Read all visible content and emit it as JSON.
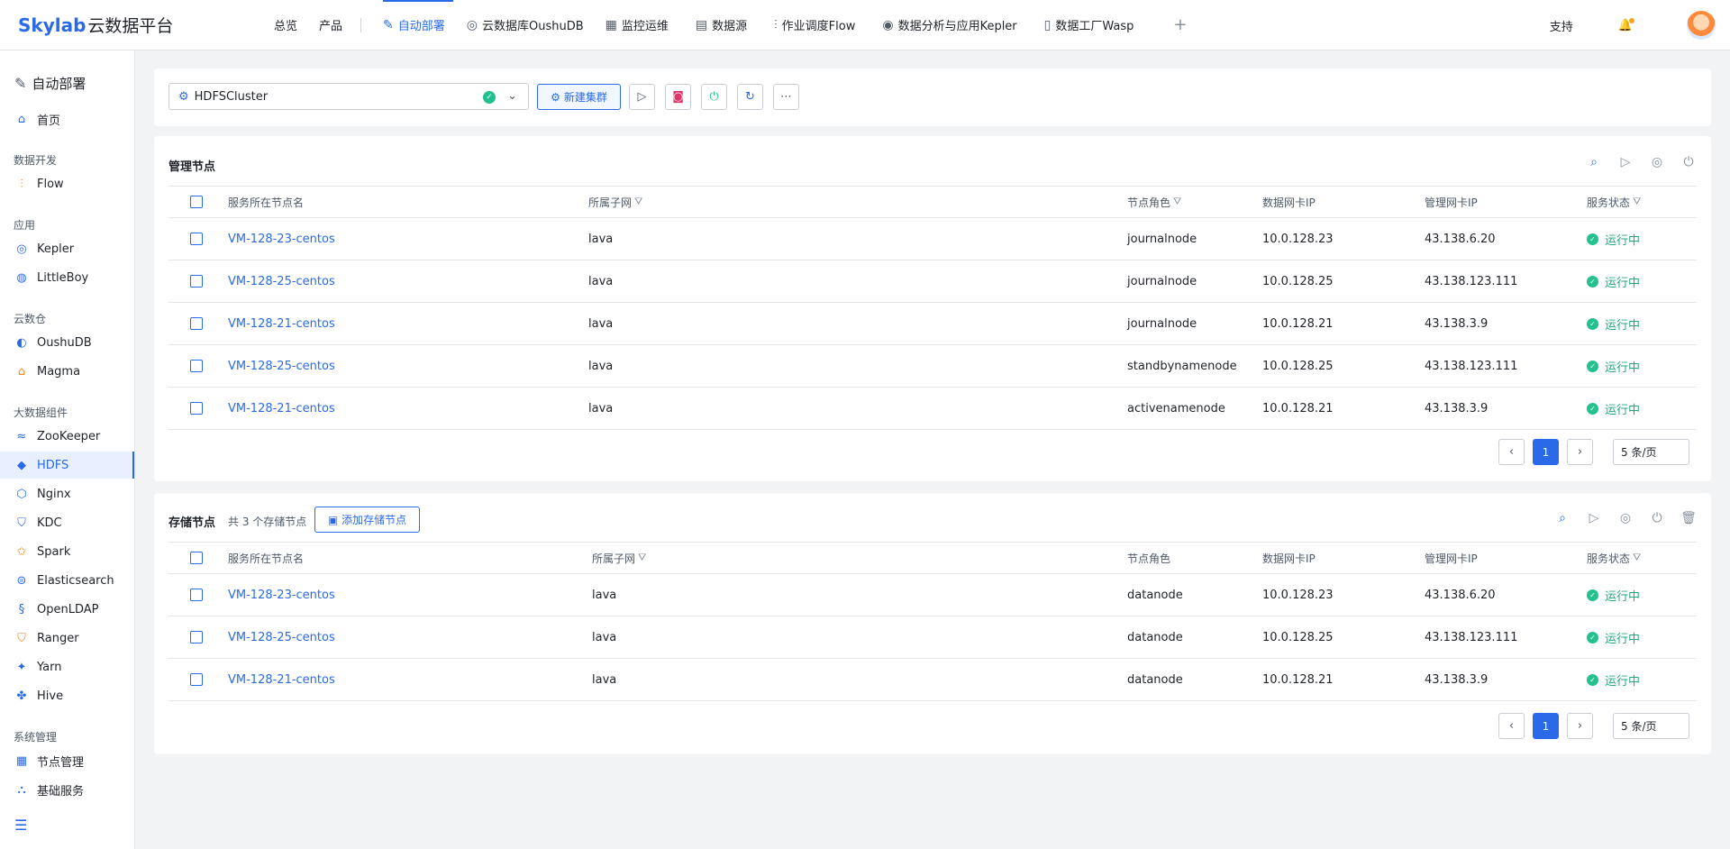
{
  "header": {
    "logo_text": "Skylab",
    "logo_cn": "云数据平台",
    "nav": [
      {
        "label": "总览",
        "icon": ""
      },
      {
        "label": "产品",
        "icon": ""
      },
      {
        "label": "自动部署",
        "icon": "wrench-icon",
        "active": true
      },
      {
        "label": "云数据库OushuDB",
        "icon": "db-icon"
      },
      {
        "label": "监控运维",
        "icon": "monitor-icon"
      },
      {
        "label": "数据源",
        "icon": "doc-icon"
      },
      {
        "label": "作业调度Flow",
        "icon": "flow-icon"
      },
      {
        "label": "数据分析与应用Kepler",
        "icon": "target-icon"
      },
      {
        "label": "数据工厂Wasp",
        "icon": "factory-icon"
      }
    ],
    "support": "支持"
  },
  "sidebar": {
    "title": "自动部署",
    "home": "首页",
    "groups": [
      {
        "label": "数据开发",
        "items": [
          "Flow"
        ]
      },
      {
        "label": "应用",
        "items": [
          "Kepler",
          "LittleBoy"
        ]
      },
      {
        "label": "云数仓",
        "items": [
          "OushuDB",
          "Magma"
        ]
      },
      {
        "label": "大数据组件",
        "items": [
          "ZooKeeper",
          "HDFS",
          "Nginx",
          "KDC",
          "Spark",
          "Elasticsearch",
          "OpenLDAP",
          "Ranger",
          "Yarn",
          "Hive"
        ]
      },
      {
        "label": "系统管理",
        "items": [
          "节点管理",
          "基础服务"
        ]
      }
    ],
    "active": "HDFS"
  },
  "toolbar": {
    "cluster": "HDFSCluster",
    "new_cluster": "新建集群"
  },
  "columns": {
    "host": "服务所在节点名",
    "subnet": "所属子网",
    "role": "节点角色",
    "data_ip": "数据网卡IP",
    "mgmt_ip": "管理网卡IP",
    "status": "服务状态"
  },
  "management": {
    "title": "管理节点",
    "rows": [
      {
        "host": "VM-128-23-centos",
        "subnet": "lava",
        "role": "journalnode",
        "data_ip": "10.0.128.23",
        "mgmt_ip": "43.138.6.20",
        "status": "运行中"
      },
      {
        "host": "VM-128-25-centos",
        "subnet": "lava",
        "role": "journalnode",
        "data_ip": "10.0.128.25",
        "mgmt_ip": "43.138.123.111",
        "status": "运行中"
      },
      {
        "host": "VM-128-21-centos",
        "subnet": "lava",
        "role": "journalnode",
        "data_ip": "10.0.128.21",
        "mgmt_ip": "43.138.3.9",
        "status": "运行中"
      },
      {
        "host": "VM-128-25-centos",
        "subnet": "lava",
        "role": "standbynamenode",
        "data_ip": "10.0.128.25",
        "mgmt_ip": "43.138.123.111",
        "status": "运行中"
      },
      {
        "host": "VM-128-21-centos",
        "subnet": "lava",
        "role": "activenamenode",
        "data_ip": "10.0.128.21",
        "mgmt_ip": "43.138.3.9",
        "status": "运行中"
      }
    ],
    "page": "1",
    "page_size": "5 条/页"
  },
  "storage": {
    "title": "存储节点",
    "count_text": "共 3 个存储节点",
    "add_button": "添加存储节点",
    "rows": [
      {
        "host": "VM-128-23-centos",
        "subnet": "lava",
        "role": "datanode",
        "data_ip": "10.0.128.23",
        "mgmt_ip": "43.138.6.20",
        "status": "运行中"
      },
      {
        "host": "VM-128-25-centos",
        "subnet": "lava",
        "role": "datanode",
        "data_ip": "10.0.128.25",
        "mgmt_ip": "43.138.123.111",
        "status": "运行中"
      },
      {
        "host": "VM-128-21-centos",
        "subnet": "lava",
        "role": "datanode",
        "data_ip": "10.0.128.21",
        "mgmt_ip": "43.138.3.9",
        "status": "运行中"
      }
    ],
    "page": "1",
    "page_size": "5 条/页"
  },
  "colors": {
    "accent": "#2a6ae9",
    "running": "#23a77b"
  }
}
